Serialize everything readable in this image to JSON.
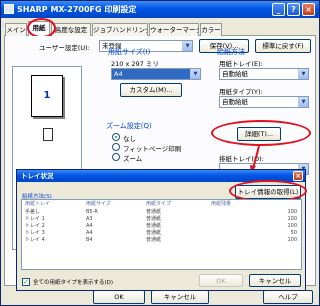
{
  "window": {
    "title": "SHARP MX-2700FG 印刷設定",
    "min_glyph": "_",
    "help_glyph": "?",
    "close_glyph": "×"
  },
  "tabs": [
    "メイン",
    "用紙",
    "高度な設定",
    "ジョブハンドリング",
    "ウォーターマーク",
    "カラー"
  ],
  "user_settings": {
    "label": "ユーザー設定(U):",
    "value": "未登録",
    "save_button": "保存(V)...",
    "restore_button": "標準に戻す(F)"
  },
  "preview": {
    "page_number": "1"
  },
  "paper_size": {
    "title": "用紙サイズ(I)",
    "dimensions": "210 x 297 ミリ",
    "value": "A4",
    "custom_button": "カスタム(M)..."
  },
  "zoom": {
    "title": "ズーム設定(Q)",
    "options": [
      "なし",
      "フィットページ印刷",
      "ズーム"
    ]
  },
  "paper_source": {
    "title": "給紙方法",
    "tray_label": "用紙トレイ(E):",
    "tray_value": "自動給紙",
    "type_label": "用紙タイプ(Y):",
    "type_value": "自動給紙",
    "detail_button": "詳細(T)...",
    "output_label": "排紙トレイ(O):"
  },
  "bottom_buttons": [
    "OK",
    "キャンセル",
    "ヘルプ"
  ],
  "tray_dialog": {
    "title": "トレイ状況",
    "fetch_button": "トレイ情報の取得(L)",
    "group_title": "給紙方法(S)",
    "columns": [
      "用紙トレイ",
      "用紙サイズ",
      "用紙タイプ",
      "用紙残量"
    ],
    "rows": [
      [
        "手差し",
        "B5-R",
        "普通紙",
        "100"
      ],
      [
        "トレイ 1",
        "A3",
        "普通紙",
        "100"
      ],
      [
        "トレイ 2",
        "A4",
        "普通紙",
        "100"
      ],
      [
        "トレイ 3",
        "A4",
        "普通紙",
        "50"
      ],
      [
        "トレイ 4",
        "B4",
        "普通紙",
        "100"
      ]
    ],
    "show_all_label": "全ての用紙タイプを表示する(D)",
    "ok_button": "OK",
    "cancel_button": "キャンセル"
  },
  "colors": {
    "title_bar": "#0055e5",
    "dialog_face": "#ece9d8",
    "group_title": "#0046d5",
    "highlight_ring": "#e01020",
    "selection": "#316ac5"
  },
  "icons": {
    "app": "printer-icon",
    "document": "document-icon",
    "dropdown": "chevron-down-icon",
    "close": "close-icon"
  }
}
